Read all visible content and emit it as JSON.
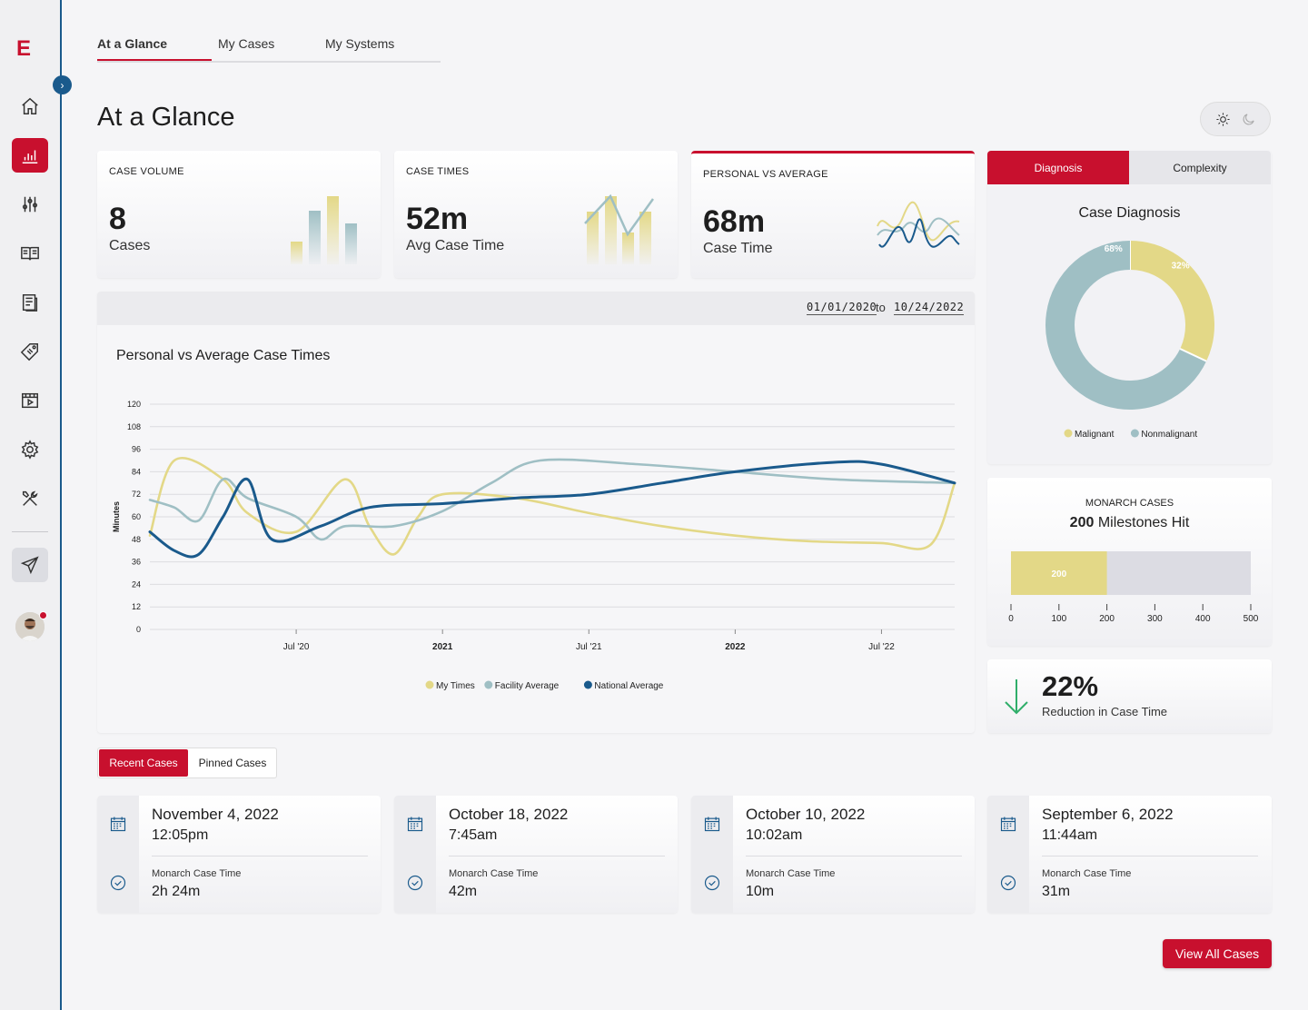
{
  "app": {
    "logo": "E"
  },
  "colors": {
    "brand": "#c8102e",
    "my_times": "#e3d887",
    "facility": "#9fbfc4",
    "national": "#1a5a8c",
    "success": "#2fae6a"
  },
  "sidebar": {
    "items": [
      {
        "name": "home-icon"
      },
      {
        "name": "bar-chart-icon",
        "active": true
      },
      {
        "name": "sliders-icon"
      },
      {
        "name": "book-icon"
      },
      {
        "name": "document-icon"
      },
      {
        "name": "tag-icon"
      },
      {
        "name": "video-icon"
      },
      {
        "name": "gear-icon"
      },
      {
        "name": "tools-icon"
      },
      {
        "name": "send-icon"
      }
    ]
  },
  "tabs": [
    {
      "label": "At a Glance",
      "active": true
    },
    {
      "label": "My Cases"
    },
    {
      "label": "My Systems"
    }
  ],
  "page": {
    "title": "At a Glance"
  },
  "stats": {
    "volume": {
      "label": "CASE VOLUME",
      "value": "8",
      "sub": "Cases"
    },
    "times": {
      "label": "CASE TIMES",
      "value": "52m",
      "sub": "Avg Case Time"
    },
    "personal": {
      "label": "PERSONAL VS AVERAGE",
      "value": "68m",
      "sub": "Case Time"
    }
  },
  "date_range": {
    "from": "01/01/2020",
    "to_label": "to",
    "to": "10/24/2022"
  },
  "diagnosis": {
    "tabs": [
      "Diagnosis",
      "Complexity"
    ],
    "title": "Case Diagnosis"
  },
  "monarch": {
    "label": "MONARCH CASES",
    "value": "200",
    "suffix": "Milestones Hit"
  },
  "reduction": {
    "value": "22%",
    "sub": "Reduction in Case Time"
  },
  "case_tabs": [
    "Recent Cases",
    "Pinned Cases"
  ],
  "cases": [
    {
      "date": "November 4, 2022",
      "time": "12:05pm",
      "metric_label": "Monarch Case Time",
      "metric_value": "2h 24m"
    },
    {
      "date": "October 18, 2022",
      "time": "7:45am",
      "metric_label": "Monarch Case Time",
      "metric_value": "42m"
    },
    {
      "date": "October 10, 2022",
      "time": "10:02am",
      "metric_label": "Monarch Case Time",
      "metric_value": "10m"
    },
    {
      "date": "September 6, 2022",
      "time": "11:44am",
      "metric_label": "Monarch Case Time",
      "metric_value": "31m"
    }
  ],
  "buttons": {
    "view_all": "View All Cases"
  },
  "chart_data": [
    {
      "type": "line",
      "title": "Personal vs Average Case Times",
      "ylabel": "Minutes",
      "xlabel": "",
      "ylim": [
        0,
        120
      ],
      "yticks": [
        0,
        12,
        24,
        36,
        48,
        60,
        72,
        84,
        96,
        108,
        120
      ],
      "xticks": [
        "Jul '20",
        "2021",
        "Jul '21",
        "2022",
        "Jul '22"
      ],
      "xlim": [
        "2020-01",
        "2022-10"
      ],
      "grid": true,
      "legend": "bottom",
      "series": [
        {
          "name": "My Times",
          "points": [
            [
              "2020-01",
              50
            ],
            [
              "2020-02",
              90
            ],
            [
              "2020-04",
              80
            ],
            [
              "2020-05",
              62
            ],
            [
              "2020-07",
              52
            ],
            [
              "2020-09",
              80
            ],
            [
              "2020-10",
              55
            ],
            [
              "2020-11",
              40
            ],
            [
              "2020-12",
              60
            ],
            [
              "2021-01",
              72
            ],
            [
              "2021-04",
              70
            ],
            [
              "2021-07",
              62
            ],
            [
              "2021-10",
              55
            ],
            [
              "2022-01",
              50
            ],
            [
              "2022-04",
              47
            ],
            [
              "2022-07",
              46
            ],
            [
              "2022-09",
              45
            ],
            [
              "2022-10",
              78
            ]
          ]
        },
        {
          "name": "Facility Average",
          "points": [
            [
              "2020-01",
              69
            ],
            [
              "2020-02",
              65
            ],
            [
              "2020-03",
              58
            ],
            [
              "2020-04",
              80
            ],
            [
              "2020-05",
              70
            ],
            [
              "2020-07",
              60
            ],
            [
              "2020-08",
              48
            ],
            [
              "2020-09",
              55
            ],
            [
              "2020-11",
              55
            ],
            [
              "2021-01",
              63
            ],
            [
              "2021-03",
              78
            ],
            [
              "2021-05",
              90
            ],
            [
              "2021-09",
              88
            ],
            [
              "2022-01",
              84
            ],
            [
              "2022-05",
              80
            ],
            [
              "2022-10",
              78
            ]
          ]
        },
        {
          "name": "National Average",
          "points": [
            [
              "2020-01",
              52
            ],
            [
              "2020-02",
              42
            ],
            [
              "2020-03",
              40
            ],
            [
              "2020-04",
              60
            ],
            [
              "2020-05",
              80
            ],
            [
              "2020-06",
              48
            ],
            [
              "2020-08",
              55
            ],
            [
              "2020-10",
              65
            ],
            [
              "2021-01",
              67
            ],
            [
              "2021-04",
              70
            ],
            [
              "2021-07",
              72
            ],
            [
              "2021-10",
              78
            ],
            [
              "2022-01",
              84
            ],
            [
              "2022-05",
              89
            ],
            [
              "2022-07",
              88
            ],
            [
              "2022-10",
              78
            ]
          ]
        }
      ]
    },
    {
      "type": "pie",
      "title": "Case Diagnosis",
      "categories": [
        "Malignant",
        "Nonmalignant"
      ],
      "values": [
        32,
        68
      ],
      "labels": [
        "32%",
        "68%"
      ],
      "legend": "bottom"
    },
    {
      "type": "bar",
      "title": "MONARCH CASES",
      "orientation": "horizontal",
      "values": [
        200
      ],
      "labels": [
        "200"
      ],
      "xlim": [
        0,
        500
      ],
      "xticks": [
        0,
        100,
        200,
        300,
        400,
        500
      ]
    },
    {
      "type": "bar",
      "title": "CASE VOLUME",
      "values": [
        1,
        3,
        4,
        2
      ],
      "legend": "none"
    }
  ]
}
